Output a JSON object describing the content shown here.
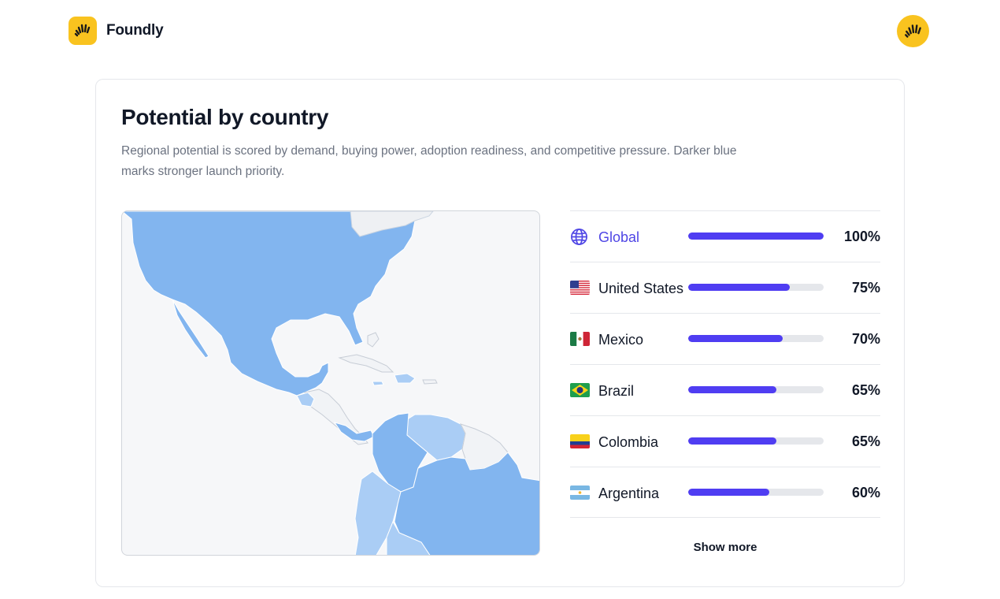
{
  "app": {
    "name": "Foundly"
  },
  "colors": {
    "accent": "#4f46e5",
    "bar": "#4f3df2",
    "brand": "#f9c31f",
    "map_land": "#82b5ef"
  },
  "card": {
    "title": "Potential by country",
    "description": "Regional potential is scored by demand, buying power, adoption readiness, and competitive pressure. Darker blue marks stronger launch priority."
  },
  "countries": [
    {
      "name": "Global",
      "value_label": "100%",
      "value": 1.0,
      "icon": "globe-icon"
    },
    {
      "name": "United States",
      "value_label": "75%",
      "value": 0.75,
      "icon": "us-flag-icon"
    },
    {
      "name": "Mexico",
      "value_label": "70%",
      "value": 0.7,
      "icon": "mexico-flag-icon"
    },
    {
      "name": "Brazil",
      "value_label": "65%",
      "value": 0.65,
      "icon": "brazil-flag-icon"
    },
    {
      "name": "Colombia",
      "value_label": "65%",
      "value": 0.65,
      "icon": "colombia-flag-icon"
    },
    {
      "name": "Argentina",
      "value_label": "60%",
      "value": 0.6,
      "icon": "argentina-flag-icon"
    }
  ],
  "show_more_label": "Show more"
}
